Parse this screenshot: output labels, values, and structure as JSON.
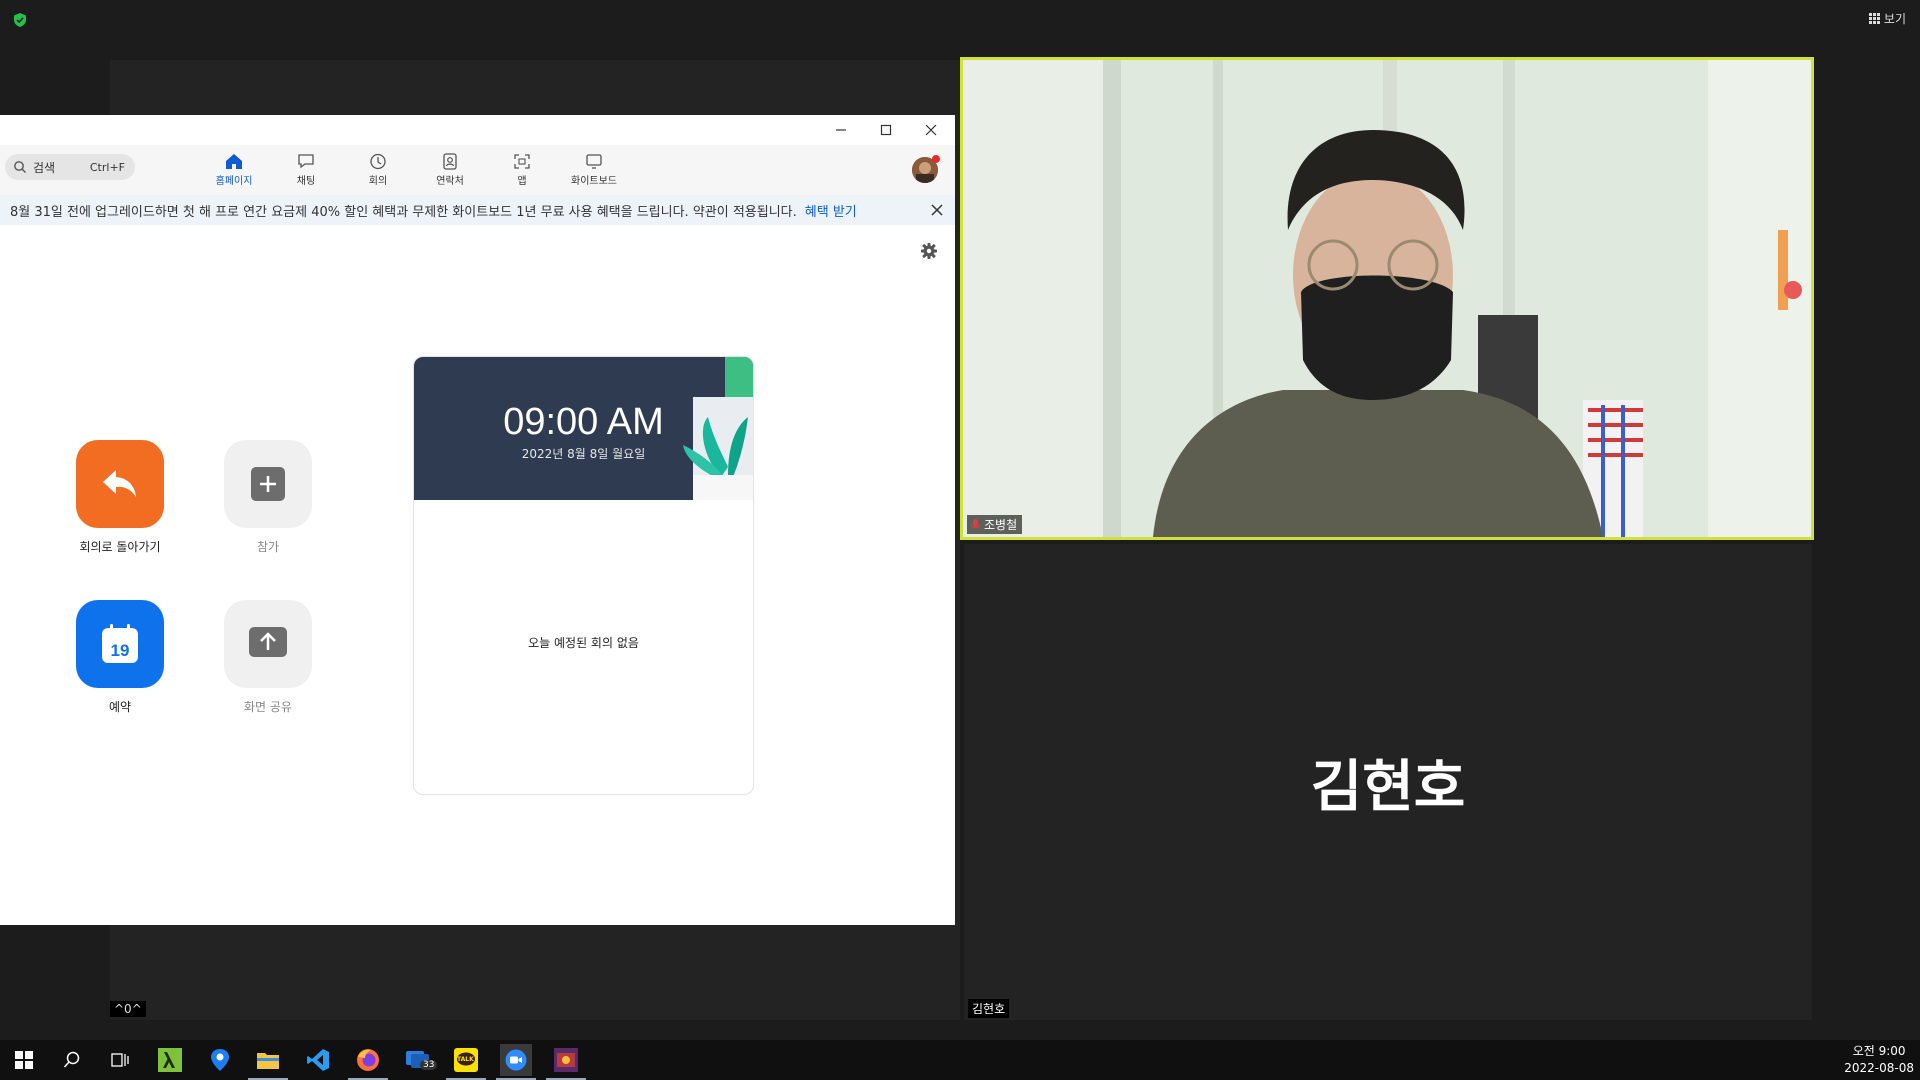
{
  "topbar": {
    "view_label": "보기"
  },
  "window": {
    "title_buttons": [
      "minimize",
      "maximize",
      "close"
    ],
    "search": {
      "label": "검색",
      "shortcut": "Ctrl+F"
    },
    "tabs": [
      {
        "label": "홈페이지",
        "icon": "home-icon",
        "active": true
      },
      {
        "label": "채팅",
        "icon": "chat-icon",
        "active": false
      },
      {
        "label": "회의",
        "icon": "clock-icon",
        "active": false
      },
      {
        "label": "연락처",
        "icon": "contacts-icon",
        "active": false
      },
      {
        "label": "앱",
        "icon": "apps-icon",
        "active": false
      },
      {
        "label": "화이트보드",
        "icon": "whiteboard-icon",
        "active": false
      }
    ],
    "banner": {
      "text": "8월 31일 전에 업그레이드하면 첫 해 프로 연간 요금제 40% 할인 혜택과 무제한 화이트보드 1년 무료 사용 혜택을 드립니다. 약관이 적용됩니다.",
      "link": "혜택 받기"
    },
    "actions": [
      {
        "label": "회의로 돌아가기",
        "icon": "return-arrow-icon",
        "color": "#f26d21"
      },
      {
        "label": "참가",
        "icon": "plus-icon",
        "color": "#f0f0f0"
      },
      {
        "label": "예약",
        "icon": "calendar-icon",
        "color": "#0e72ed",
        "calendar_day": "19"
      },
      {
        "label": "화면 공유",
        "icon": "share-up-icon",
        "color": "#f0f0f0"
      }
    ],
    "calendar": {
      "time": "09:00 AM",
      "date": "2022년 8월 8일 월요일",
      "empty_text": "오늘 예정된 회의 없음"
    }
  },
  "meeting": {
    "participant_1": {
      "name": "조병철"
    },
    "participant_2": {
      "name": "김현호",
      "display_name": "김현호"
    },
    "more_label": "···",
    "emote_text": "^0^",
    "active_speaker_border": "#cfe23a"
  },
  "taskbar": {
    "apps": [
      "windows-start-icon",
      "search-icon",
      "task-view-icon",
      "lambda-app-icon",
      "maps-icon",
      "file-explorer-icon",
      "vscode-icon",
      "firefox-icon",
      "mail-icon",
      "kakaotalk-icon",
      "zoom-icon",
      "game-icon"
    ],
    "mail_badge": "33",
    "kakao_label": "TALK",
    "clock_time": "오전 9:00",
    "clock_date": "2022-08-08"
  }
}
